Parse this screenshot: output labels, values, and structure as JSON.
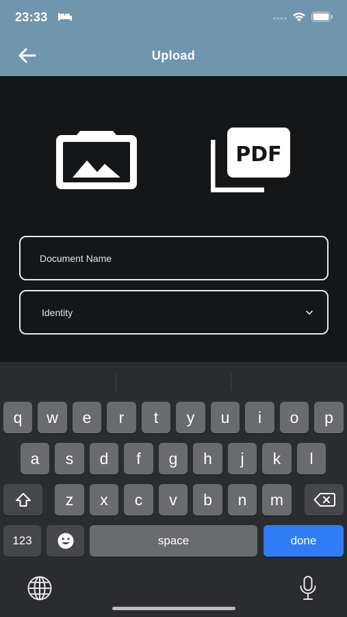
{
  "status_bar": {
    "time": "23:33"
  },
  "header": {
    "title": "Upload"
  },
  "form": {
    "document_name_placeholder": "Document Name",
    "document_name_value": "",
    "document_type_selected": "Identity"
  },
  "keyboard": {
    "row1": [
      "q",
      "w",
      "e",
      "r",
      "t",
      "y",
      "u",
      "i",
      "o",
      "p"
    ],
    "row2": [
      "a",
      "s",
      "d",
      "f",
      "g",
      "h",
      "j",
      "k",
      "l"
    ],
    "row3": [
      "z",
      "x",
      "c",
      "v",
      "b",
      "n",
      "m"
    ],
    "numbers_label": "123",
    "space_label": "space",
    "done_label": "done"
  },
  "colors": {
    "header_bg": "#7096ad",
    "background": "#141618",
    "keyboard_bg": "#2b2c2e",
    "key_bg": "#6a6b6e",
    "done_key_bg": "#2f7cf6"
  }
}
